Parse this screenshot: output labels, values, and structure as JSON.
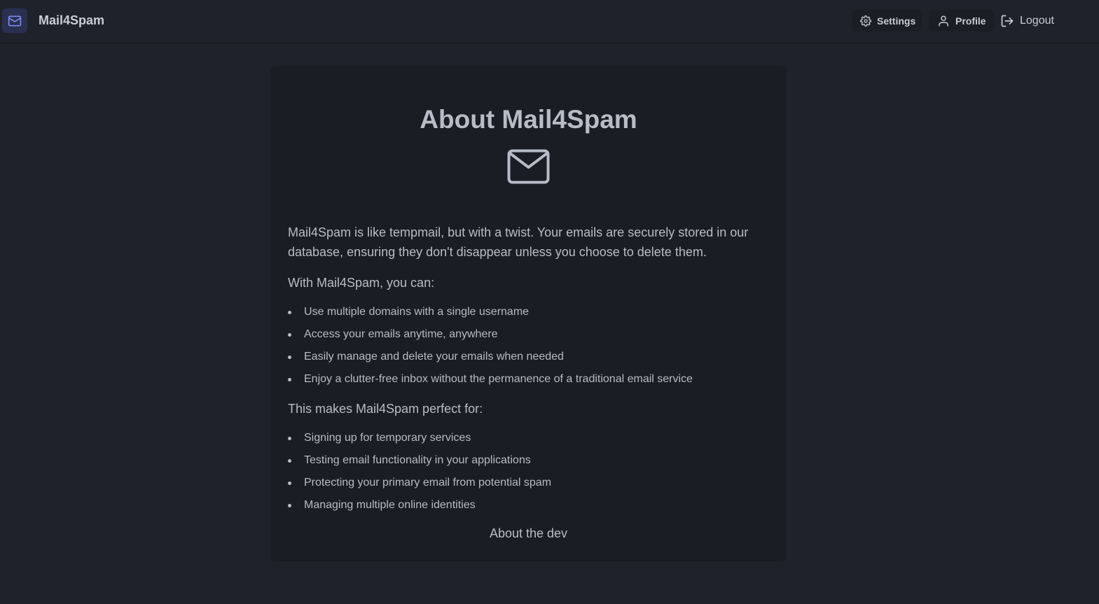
{
  "header": {
    "brand": "Mail4Spam",
    "settings_label": "Settings",
    "profile_label": "Profile",
    "logout_label": "Logout"
  },
  "main": {
    "title": "About Mail4Spam",
    "intro": "Mail4Spam is like tempmail, but with a twist. Your emails are securely stored in our database, ensuring they don't disappear unless you choose to delete them.",
    "features_heading": "With Mail4Spam, you can:",
    "features": [
      "Use multiple domains with a single username",
      "Access your emails anytime, anywhere",
      "Easily manage and delete your emails when needed",
      "Enjoy a clutter-free inbox without the permanence of a traditional email service"
    ],
    "uses_heading": "This makes Mail4Spam perfect for:",
    "uses": [
      "Signing up for temporary services",
      "Testing email functionality in your applications",
      "Protecting your primary email from potential spam",
      "Managing multiple online identities"
    ],
    "about_dev_link": "About the dev"
  },
  "icons": {
    "brand": "mail-icon",
    "settings": "gear-icon",
    "profile": "user-icon",
    "logout": "logout-icon",
    "hero": "envelope-icon"
  },
  "colors": {
    "background": "#1e232b",
    "card": "#1a1d24",
    "brand_icon_bg": "#2a3050",
    "brand_icon_stroke": "#7c8cf0"
  }
}
